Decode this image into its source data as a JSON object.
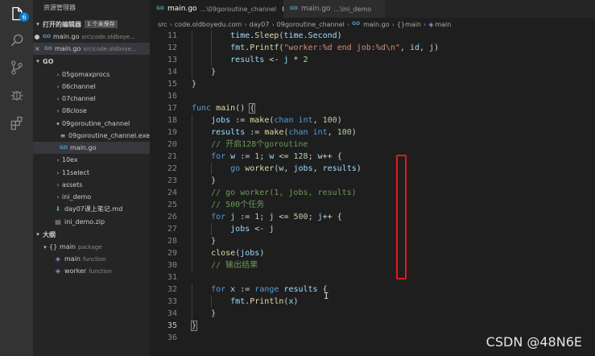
{
  "activity_bar": {
    "badge": "6",
    "icons": [
      "files-icon",
      "search-icon",
      "source-control-icon",
      "debug-icon",
      "extensions-icon"
    ]
  },
  "sidebar": {
    "title": "资源管理器",
    "open_editors": {
      "header": "打开的编辑器",
      "badge": "1 个未保存",
      "items": [
        {
          "name": "main.go",
          "desc": "src\\code.oldboye...",
          "modified": true
        },
        {
          "name": "main.go",
          "desc": "src\\code.oldboye...",
          "modified": false
        }
      ]
    },
    "folder": {
      "header": "GO",
      "items": [
        {
          "label": "05gomaxprocs",
          "type": "folder",
          "expanded": false
        },
        {
          "label": "06channel",
          "type": "folder",
          "expanded": false
        },
        {
          "label": "07channel",
          "type": "folder",
          "expanded": false
        },
        {
          "label": "08close",
          "type": "folder",
          "expanded": false
        },
        {
          "label": "09goroutine_channel",
          "type": "folder",
          "expanded": true
        },
        {
          "label": "09goroutine_channel.exe",
          "type": "exe"
        },
        {
          "label": "main.go",
          "type": "go",
          "selected": true
        },
        {
          "label": "10ex",
          "type": "folder",
          "expanded": false
        },
        {
          "label": "11select",
          "type": "folder",
          "expanded": false
        },
        {
          "label": "assets",
          "type": "folder",
          "expanded": false
        },
        {
          "label": "ini_demo",
          "type": "folder",
          "expanded": false
        },
        {
          "label": "day07课上笔记.md",
          "type": "md"
        },
        {
          "label": "ini_demo.zip",
          "type": "zip"
        }
      ]
    },
    "outline": {
      "header": "大纲",
      "items": [
        {
          "label": "main",
          "desc": "package",
          "icon": "{}"
        },
        {
          "label": "main",
          "desc": "function",
          "icon": "cube"
        },
        {
          "label": "worker",
          "desc": "function",
          "icon": "cube"
        }
      ]
    }
  },
  "tabs": [
    {
      "name": "main.go",
      "desc": "...\\09goroutine_channel",
      "active": true,
      "modified": true
    },
    {
      "name": "main.go",
      "desc": "...\\ini_demo",
      "active": false,
      "modified": false
    }
  ],
  "breadcrumb": [
    "src",
    "code.oldboyedu.com",
    "day07",
    "09goroutine_channel",
    "main.go",
    "{}main",
    "main"
  ],
  "editor": {
    "current_line": 35,
    "lines": [
      {
        "n": "11",
        "indent": 2,
        "tokens": [
          [
            "var",
            "time"
          ],
          [
            "",
            "."
          ],
          [
            "fn",
            "Sleep"
          ],
          [
            "",
            "("
          ],
          [
            "var",
            "time"
          ],
          [
            "",
            "."
          ],
          [
            "var",
            "Second"
          ],
          [
            "",
            ")"
          ]
        ]
      },
      {
        "n": "12",
        "indent": 2,
        "tokens": [
          [
            "var",
            "fmt"
          ],
          [
            "",
            "."
          ],
          [
            "fn",
            "Printf"
          ],
          [
            "",
            "("
          ],
          [
            "str",
            "\"worker:%d end job:%d\\n\""
          ],
          [
            "",
            ", "
          ],
          [
            "var",
            "id"
          ],
          [
            "",
            ", "
          ],
          [
            "var",
            "j"
          ],
          [
            "",
            ")"
          ]
        ]
      },
      {
        "n": "13",
        "indent": 2,
        "tokens": [
          [
            "var",
            "results"
          ],
          [
            "",
            " <- "
          ],
          [
            "var",
            "j"
          ],
          [
            "",
            " * "
          ],
          [
            "num",
            "2"
          ]
        ]
      },
      {
        "n": "14",
        "indent": 1,
        "tokens": [
          [
            "",
            "}"
          ]
        ]
      },
      {
        "n": "15",
        "indent": 0,
        "tokens": [
          [
            "",
            "}"
          ]
        ]
      },
      {
        "n": "16",
        "indent": 0,
        "tokens": []
      },
      {
        "n": "17",
        "indent": 0,
        "tokens": [
          [
            "kw",
            "func"
          ],
          [
            "",
            " "
          ],
          [
            "fn",
            "main"
          ],
          [
            "",
            "() "
          ],
          [
            "bm",
            "{"
          ]
        ]
      },
      {
        "n": "18",
        "indent": 1,
        "tokens": [
          [
            "var",
            "jobs"
          ],
          [
            "",
            " := "
          ],
          [
            "fn",
            "make"
          ],
          [
            "",
            "("
          ],
          [
            "kw",
            "chan"
          ],
          [
            "",
            " "
          ],
          [
            "kw",
            "int"
          ],
          [
            "",
            ", "
          ],
          [
            "num",
            "100"
          ],
          [
            "",
            ")"
          ]
        ]
      },
      {
        "n": "19",
        "indent": 1,
        "tokens": [
          [
            "var",
            "results"
          ],
          [
            "",
            " := "
          ],
          [
            "fn",
            "make"
          ],
          [
            "",
            "("
          ],
          [
            "kw",
            "chan"
          ],
          [
            "",
            " "
          ],
          [
            "kw",
            "int"
          ],
          [
            "",
            ", "
          ],
          [
            "num",
            "100"
          ],
          [
            "",
            ")"
          ]
        ]
      },
      {
        "n": "20",
        "indent": 1,
        "tokens": [
          [
            "cmt",
            "// 开启128个goroutine"
          ]
        ]
      },
      {
        "n": "21",
        "indent": 1,
        "tokens": [
          [
            "kw",
            "for"
          ],
          [
            "",
            " "
          ],
          [
            "var",
            "w"
          ],
          [
            "",
            " := "
          ],
          [
            "num",
            "1"
          ],
          [
            "",
            "; "
          ],
          [
            "var",
            "w"
          ],
          [
            "",
            " <= "
          ],
          [
            "num",
            "128"
          ],
          [
            "",
            "; "
          ],
          [
            "var",
            "w"
          ],
          [
            "",
            "++ {"
          ]
        ]
      },
      {
        "n": "22",
        "indent": 2,
        "tokens": [
          [
            "kw",
            "go"
          ],
          [
            "",
            " "
          ],
          [
            "fn",
            "worker"
          ],
          [
            "",
            "("
          ],
          [
            "var",
            "w"
          ],
          [
            "",
            ", "
          ],
          [
            "var",
            "jobs"
          ],
          [
            "",
            ", "
          ],
          [
            "var",
            "results"
          ],
          [
            "",
            ")"
          ]
        ]
      },
      {
        "n": "23",
        "indent": 1,
        "tokens": [
          [
            "",
            "}"
          ]
        ]
      },
      {
        "n": "24",
        "indent": 1,
        "tokens": [
          [
            "cmt",
            "// go worker(1, jobs, results)"
          ]
        ]
      },
      {
        "n": "25",
        "indent": 1,
        "tokens": [
          [
            "cmt",
            "// 500个任务"
          ]
        ]
      },
      {
        "n": "26",
        "indent": 1,
        "tokens": [
          [
            "kw",
            "for"
          ],
          [
            "",
            " "
          ],
          [
            "var",
            "j"
          ],
          [
            "",
            " := "
          ],
          [
            "num",
            "1"
          ],
          [
            "",
            "; "
          ],
          [
            "var",
            "j"
          ],
          [
            "",
            " <= "
          ],
          [
            "num",
            "500"
          ],
          [
            "",
            "; "
          ],
          [
            "var",
            "j"
          ],
          [
            "",
            "++ {"
          ]
        ]
      },
      {
        "n": "27",
        "indent": 2,
        "tokens": [
          [
            "var",
            "jobs"
          ],
          [
            "",
            " <- "
          ],
          [
            "var",
            "j"
          ]
        ]
      },
      {
        "n": "28",
        "indent": 1,
        "tokens": [
          [
            "",
            "}"
          ]
        ]
      },
      {
        "n": "29",
        "indent": 1,
        "tokens": [
          [
            "fn",
            "close"
          ],
          [
            "",
            "("
          ],
          [
            "var",
            "jobs"
          ],
          [
            "",
            ")"
          ]
        ]
      },
      {
        "n": "30",
        "indent": 1,
        "tokens": [
          [
            "cmt",
            "// 输出结果"
          ]
        ]
      },
      {
        "n": "31",
        "indent": 0,
        "tokens": []
      },
      {
        "n": "32",
        "indent": 1,
        "tokens": [
          [
            "kw",
            "for"
          ],
          [
            "",
            " "
          ],
          [
            "var",
            "x"
          ],
          [
            "",
            " := "
          ],
          [
            "kw",
            "range"
          ],
          [
            "",
            " "
          ],
          [
            "var",
            "results"
          ],
          [
            "",
            " {"
          ]
        ]
      },
      {
        "n": "33",
        "indent": 2,
        "tokens": [
          [
            "var",
            "fmt"
          ],
          [
            "",
            "."
          ],
          [
            "fn",
            "Println"
          ],
          [
            "",
            "("
          ],
          [
            "var",
            "x"
          ],
          [
            "",
            ")"
          ]
        ]
      },
      {
        "n": "34",
        "indent": 1,
        "tokens": [
          [
            "",
            "}"
          ]
        ]
      },
      {
        "n": "35",
        "indent": 0,
        "tokens": [
          [
            "bm",
            "}"
          ]
        ]
      },
      {
        "n": "36",
        "indent": 0,
        "tokens": []
      }
    ]
  },
  "watermark": "CSDN @48N6E"
}
